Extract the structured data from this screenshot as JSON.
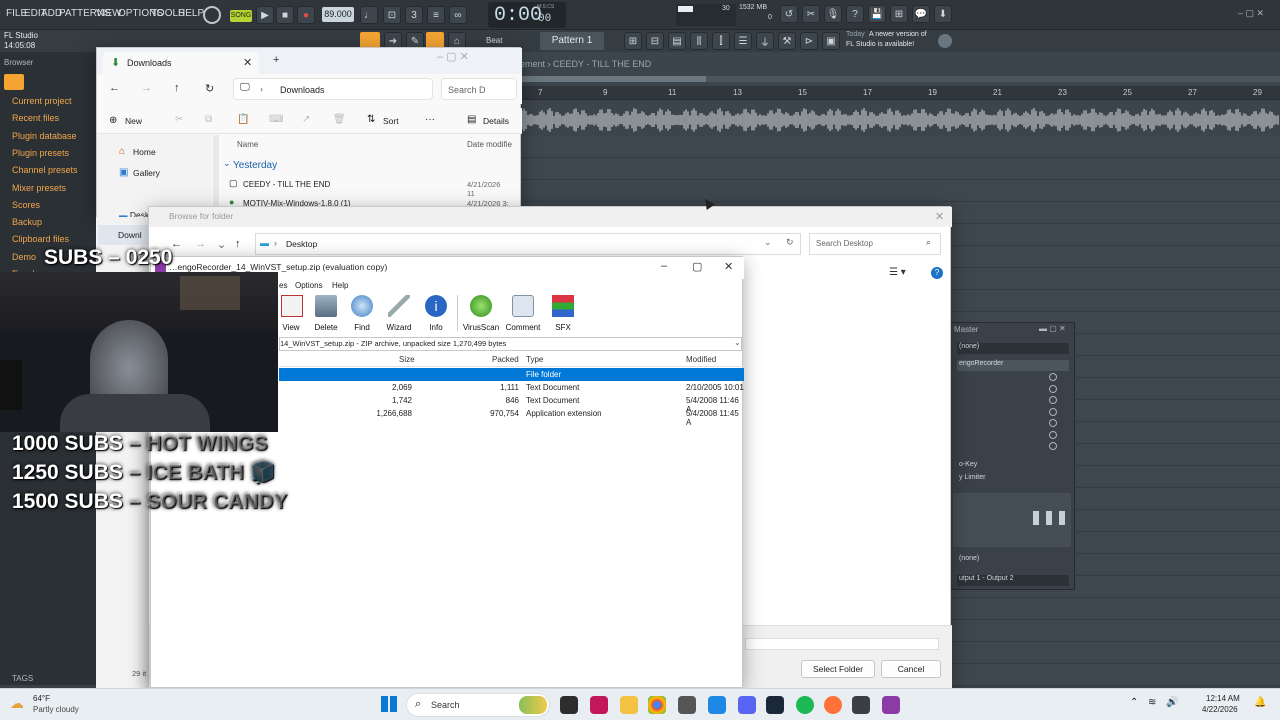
{
  "fl": {
    "menu": [
      "FILE",
      "EDIT",
      "ADD",
      "PATTERNS",
      "VIEW",
      "OPTIONS",
      "TOOLS",
      "HELP"
    ],
    "song_label": "SONG",
    "tempo": "89.000",
    "time": "0:00",
    "time_frac": "00",
    "time_unit": "M:S:CS",
    "cpu": "30",
    "mem": "1532 MB",
    "mem2": "0",
    "hint_today": "Today",
    "hint_text1": "A newer version of",
    "hint_text2": "FL Studio is available!",
    "app_name": "FL Studio",
    "clock": "14:05:08",
    "beat_label": "Beat",
    "pattern": "Pattern 1",
    "browser_title": "Browser",
    "crumb": "ement › CEEDY - TILL THE END",
    "browser_items": [
      "Current project",
      "Recent files",
      "Plugin database",
      "Plugin presets",
      "Channel presets",
      "Mixer presets",
      "Scores",
      "Backup",
      "Clipboard files",
      "Demo",
      "Envelopes",
      "User data"
    ],
    "tags": "TAGS",
    "ruler": [
      "7",
      "9",
      "11",
      "13",
      "15",
      "17",
      "19",
      "21",
      "23",
      "25",
      "27",
      "29"
    ],
    "mixer_title": "Master",
    "mixer_none": "(none)",
    "mixer_slot1": "engoRecorder",
    "mixer_key": "o-Key",
    "mixer_limiter": "y Limiter",
    "mixer_none2": "(none)",
    "mixer_output": "utput 1 - Output 2"
  },
  "downloads": {
    "tab_title": "Downloads",
    "add_tab": "+",
    "address": "Downloads",
    "search": "Search D",
    "new_label": "New",
    "sort_label": "Sort",
    "more": "···",
    "details": "Details",
    "nav": [
      "Home",
      "Gallery",
      "Desktop",
      "Downl",
      "Loca"
    ],
    "col_name": "Name",
    "col_date": "Date modifie",
    "group": "Yesterday",
    "files": [
      {
        "name": "CEEDY - TILL THE END",
        "date": "4/21/2026 11"
      },
      {
        "name": "MOTIV-Mix-Windows-1.8.0 (1)",
        "date": "4/21/2026 3:"
      }
    ],
    "status": "29 it"
  },
  "browse": {
    "title": "Browse for folder",
    "address": "Desktop",
    "search": "Search Desktop",
    "select_btn": "Select Folder",
    "cancel_btn": "Cancel"
  },
  "winrar": {
    "title": "…engoRecorder_14_WinVST_setup.zip (evaluation copy)",
    "menu": [
      "es",
      "Options",
      "Help"
    ],
    "tools": [
      "View",
      "Delete",
      "Find",
      "Wizard",
      "Info",
      "VirusScan",
      "Comment",
      "SFX"
    ],
    "path": "14_WinVST_setup.zip - ZIP archive, unpacked size 1,270,499 bytes",
    "headers": {
      "size": "Size",
      "packed": "Packed",
      "type": "Type",
      "modified": "Modified"
    },
    "rows": [
      {
        "size": "",
        "packed": "",
        "type": "File folder",
        "modified": ""
      },
      {
        "size": "2,069",
        "packed": "1,111",
        "type": "Text Document",
        "modified": "2/10/2005 10:01"
      },
      {
        "size": "1,742",
        "packed": "846",
        "type": "Text Document",
        "modified": "5/4/2008 11:46 A"
      },
      {
        "size": "1,266,688",
        "packed": "970,754",
        "type": "Application extension",
        "modified": "5/4/2008 11:45 A"
      }
    ]
  },
  "overlay": {
    "subs_top": "SUBS – 0250",
    "goals": [
      {
        "count": "1000 SUBS",
        "reward": " – HOT WINGS"
      },
      {
        "count": "1250 SUBS",
        "reward": " – ICE BATH 🧊"
      },
      {
        "count": "1500 SUBS",
        "reward": " – SOUR CANDY"
      }
    ]
  },
  "taskbar": {
    "temp": "64°F",
    "weather": "Partly cloudy",
    "search": "Search",
    "time": "12:14 AM",
    "date": "4/22/2026"
  },
  "colors": {
    "accent": "#0078d4",
    "fl_orange": "#f1a64c",
    "selection": "#0078d7"
  }
}
